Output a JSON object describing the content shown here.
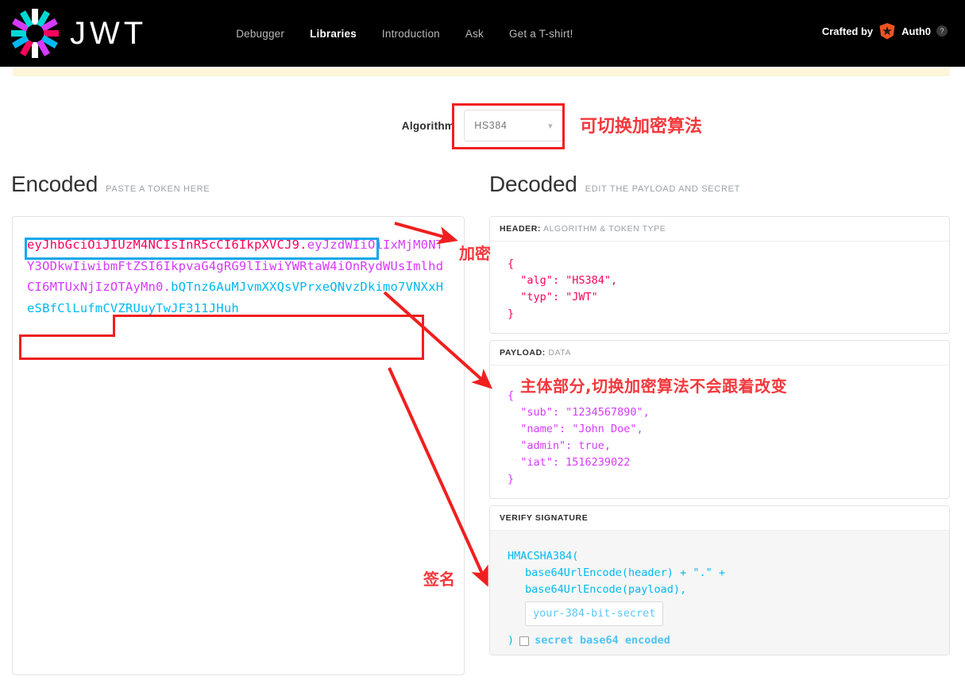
{
  "header": {
    "logo_text": "JWT",
    "logo_icon": "jwt-starburst-icon",
    "nav": [
      {
        "label": "Debugger",
        "active": false
      },
      {
        "label": "Libraries",
        "active": true
      },
      {
        "label": "Introduction",
        "active": false
      },
      {
        "label": "Ask",
        "active": false
      },
      {
        "label": "Get a T-shirt!",
        "active": false
      }
    ],
    "crafted_by": "Crafted by",
    "auth0_label": "Auth0",
    "help_icon": "question-mark-icon"
  },
  "algorithm": {
    "label": "Algorithm",
    "value": "HS384",
    "chevron": "chevron-down-icon"
  },
  "encoded": {
    "title": "Encoded",
    "subtitle": "PASTE A TOKEN HERE",
    "token_header": "eyJhbGciOiJIUzM4NCIsInR5cCI6IkpXVCJ9",
    "token_payload": "eyJzdWIiOiIxMjM0NTY3ODkwIiwibmFtZSI6IkpvaG4gRG9lIiwiYWRtaW4iOnRydWUsImlhdCI6MTUxNjIzOTAyMn0",
    "token_signature": "bQTnz6AuMJvmXXQsVPrxeQNvzDkimo7VNXxHeSBfClLufmCVZRUuyTwJF311JHuh",
    "dot": "."
  },
  "decoded": {
    "title": "Decoded",
    "subtitle": "EDIT THE PAYLOAD AND SECRET",
    "header_section": {
      "label": "HEADER:",
      "sub": "ALGORITHM & TOKEN TYPE",
      "json": "{\n  \"alg\": \"HS384\",\n  \"typ\": \"JWT\"\n}"
    },
    "payload_section": {
      "label": "PAYLOAD:",
      "sub": "DATA",
      "json": "{\n  \"sub\": \"1234567890\",\n  \"name\": \"John Doe\",\n  \"admin\": true,\n  \"iat\": 1516239022\n}"
    },
    "signature_section": {
      "label": "VERIFY SIGNATURE",
      "line1": "HMACSHA384(",
      "line2": "base64UrlEncode(header) + \".\" +",
      "line3": "base64UrlEncode(payload),",
      "secret_value": "your-384-bit-secret",
      "close_paren": ")",
      "checkbox_label": "secret base64 encoded"
    }
  },
  "annotations": {
    "algorithm_note": "可切换加密算法",
    "encrypt_note": "加密",
    "payload_note": "主体部分,切换加密算法不会跟着改变",
    "signature_note": "签名",
    "colors": {
      "annotation_red": "#f4383c",
      "box_red": "#f01f1f",
      "box_blue": "#12a8ea",
      "token_header": "#fb015b",
      "token_payload": "#d63aff",
      "token_signature": "#00b9f1",
      "auth0_orange": "#eb5424"
    }
  }
}
